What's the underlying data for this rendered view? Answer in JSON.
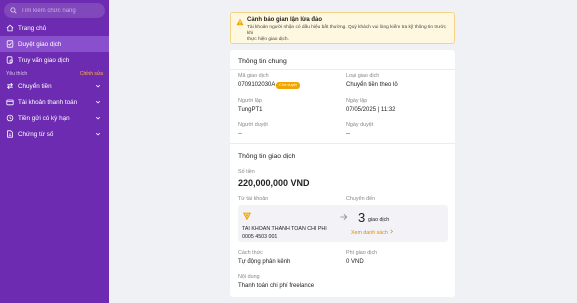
{
  "sidebar": {
    "search_placeholder": "Tìm kiếm chức năng",
    "items": [
      {
        "label": "Trang chủ"
      },
      {
        "label": "Duyệt giao dịch"
      },
      {
        "label": "Truy vấn giao dịch"
      }
    ],
    "favorites_label": "Yêu thích",
    "edit_label": "Chỉnh sửa",
    "groups": [
      {
        "label": "Chuyển tiền"
      },
      {
        "label": "Tài khoản thanh toán"
      },
      {
        "label": "Tiền gửi có kỳ hạn"
      },
      {
        "label": "Chứng từ số"
      }
    ]
  },
  "alert": {
    "title": "Cảnh báo gian lận lừa đảo",
    "body_line1": "Tài khoản người nhận có dấu hiệu bất thường. Quý khách vui lòng kiểm tra kỹ thông tin trước khi",
    "body_line2": "thực hiện giao dịch."
  },
  "general": {
    "title": "Thông tin chung",
    "txn_id_label": "Mã giao dịch",
    "txn_id": "0709102030A",
    "status_badge": "Chờ duyệt",
    "txn_type_label": "Loại giao dịch",
    "txn_type": "Chuyển tiền theo lô",
    "creator_label": "Người lập",
    "creator": "TungPT1",
    "created_date_label": "Ngày lập",
    "created_date": "07/05/2025 | 11:32",
    "approver_label": "Người duyệt",
    "approver": "--",
    "approved_date_label": "Ngày duyệt",
    "approved_date": "--"
  },
  "transaction": {
    "title": "Thông tin giao dịch",
    "amount_label": "Số tiền",
    "amount": "220,000,000 VND",
    "from_label": "Từ tài khoản",
    "to_label": "Chuyển đến",
    "account_name": "TAI KHOAN THANH TOAN CHI PHI",
    "account_no": "0005 4503 001",
    "count": "3",
    "count_unit": "giao dịch",
    "see_list": "Xem danh sách",
    "method_label": "Cách thức",
    "method": "Tự động phân kênh",
    "fee_label": "Phí giao dịch",
    "fee": "0 VND",
    "content_label": "Nội dung",
    "content": "Thanh toán chi phí freelance"
  },
  "colors": {
    "sidebar_bg": "#6c2bb0",
    "sidebar_active": "#8a4fcc",
    "accent": "#f0a500",
    "link": "#e08a00"
  },
  "icons": [
    "search-icon",
    "home-icon",
    "check-list-icon",
    "search-doc-icon",
    "transfer-icon",
    "wallet-icon",
    "savings-icon",
    "document-icon",
    "chevron-down-icon",
    "warning-icon",
    "bank-logo-icon",
    "arrow-right-icon",
    "chevron-right-icon"
  ]
}
